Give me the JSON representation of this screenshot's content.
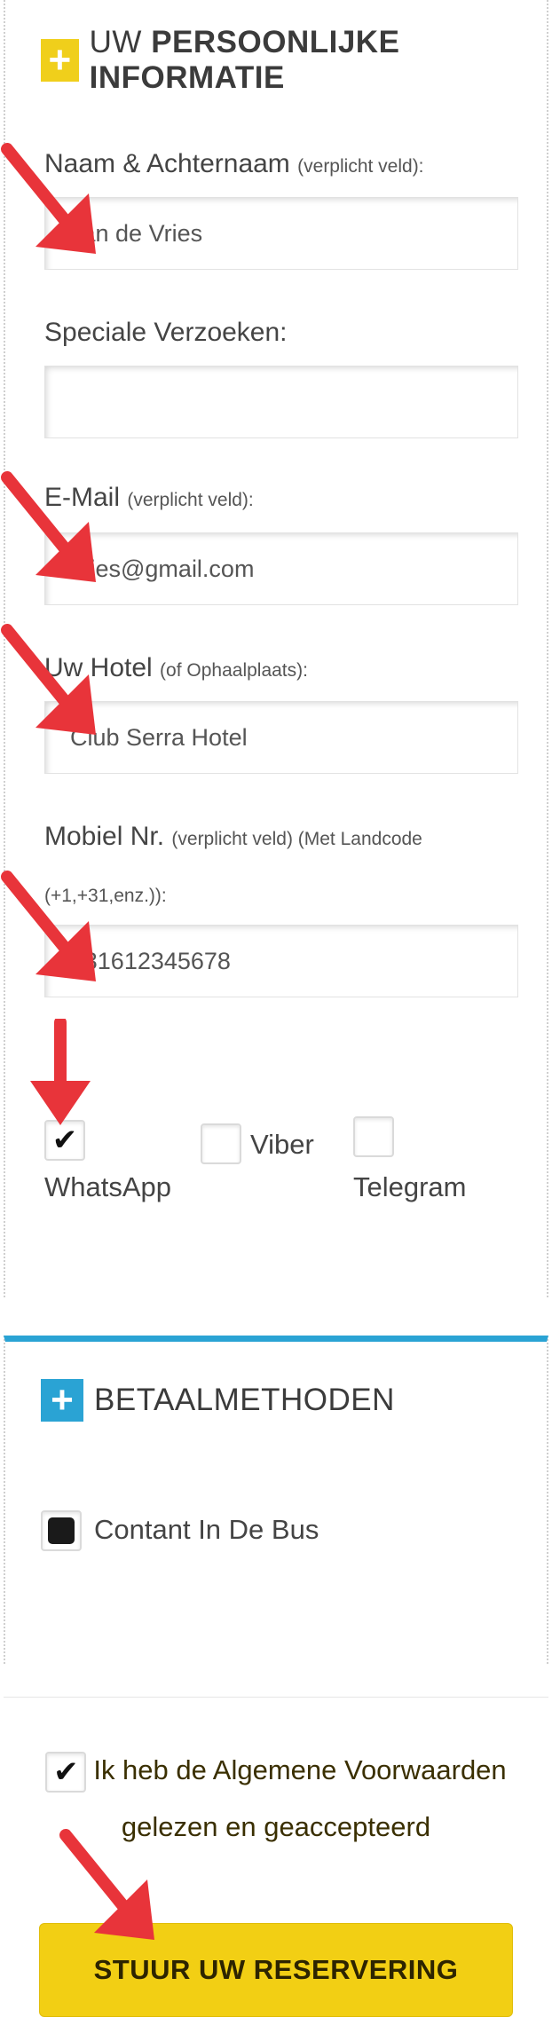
{
  "personal_section": {
    "title_prefix": "UW",
    "title_bold": "PERSOONLIJKE INFORMATIE",
    "fields": {
      "name": {
        "label": "Naam & Achternaam",
        "note": "(verplicht veld):",
        "value": "Jan de Vries"
      },
      "requests": {
        "label": "Speciale Verzoeken:",
        "value": ""
      },
      "email": {
        "label": "E-Mail",
        "note": "(verplicht veld):",
        "value": "vries@gmail.com"
      },
      "hotel": {
        "label": "Uw Hotel",
        "note": "(of Ophaalplaats):",
        "value": "Club Serra Hotel"
      },
      "mobile": {
        "label": "Mobiel Nr.",
        "note": "(verplicht veld) (Met Landcode",
        "note2": "(+1,+31,enz.)):",
        "value": "+31612345678"
      }
    },
    "messengers": [
      {
        "label": "WhatsApp",
        "checked": true
      },
      {
        "label": "Viber",
        "checked": false
      },
      {
        "label": "Telegram",
        "checked": false
      }
    ]
  },
  "payment_section": {
    "title": "BETAALMETHODEN",
    "option": {
      "label": "Contant In De Bus",
      "selected": true
    }
  },
  "terms": {
    "text": "Ik heb de Algemene Voorwaarden gelezen en geaccepteerd",
    "checked": true
  },
  "submit_label": "STUUR UW RESERVERING",
  "colors": {
    "accent_yellow": "#f0cf1b",
    "accent_blue": "#2aa3d4",
    "arrow_red": "#e8343a",
    "button_yellow": "#f2cf14"
  },
  "icons": [
    "plus-icon",
    "checkmark-icon",
    "red-arrow"
  ]
}
